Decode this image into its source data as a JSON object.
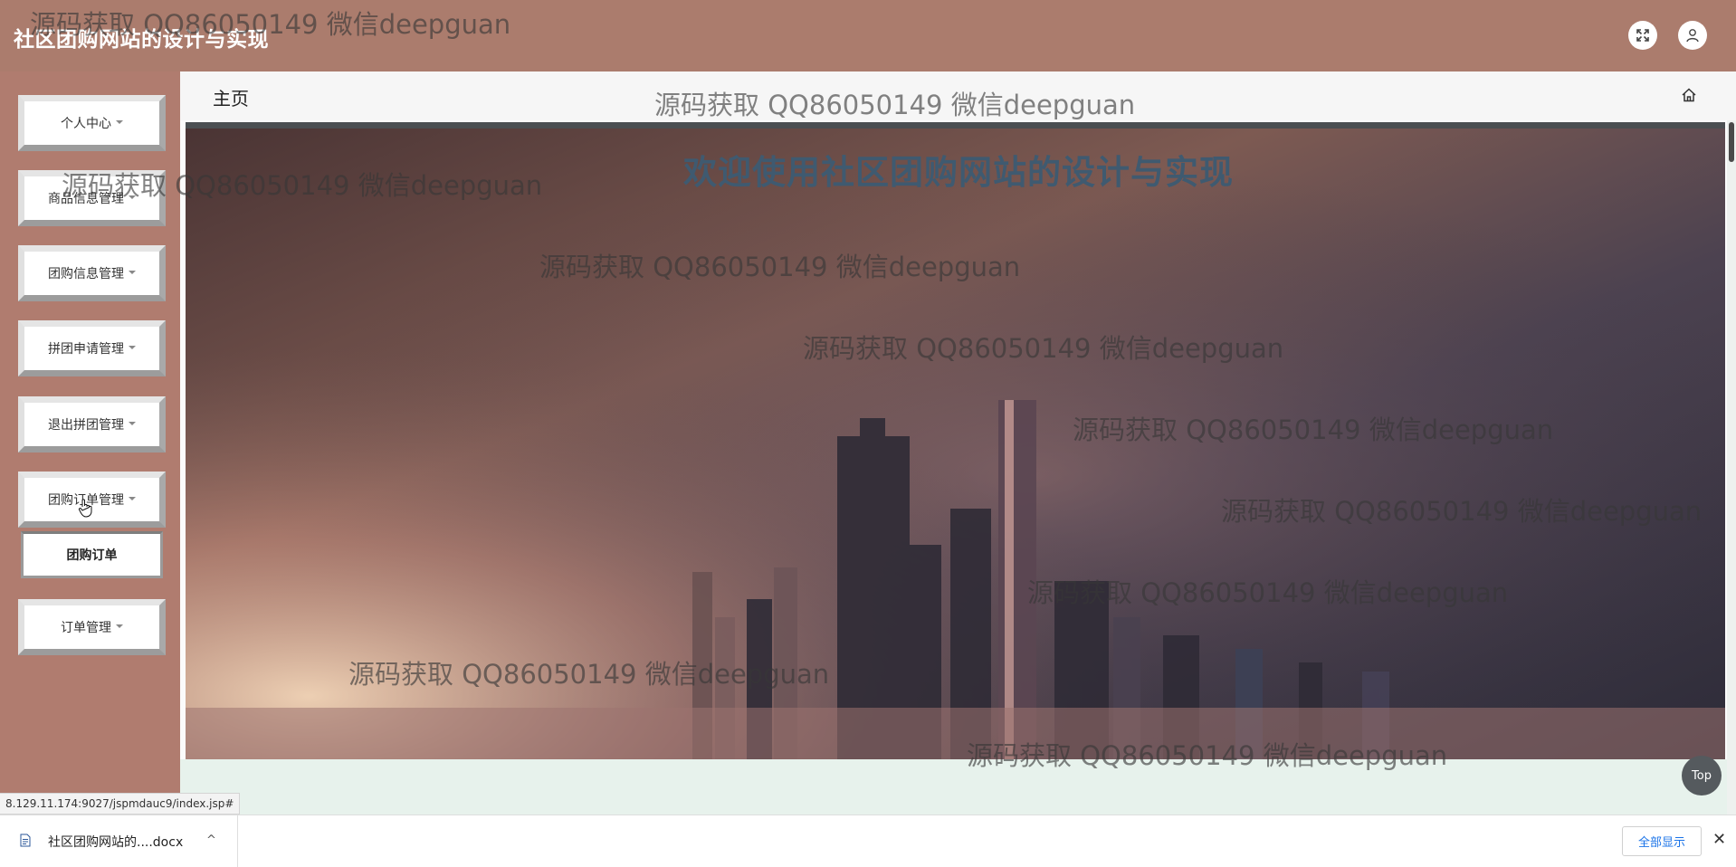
{
  "header": {
    "app_title": "社区团购网站的设计与实现",
    "fullscreen_icon": "fullscreen-icon",
    "user_icon": "user-icon"
  },
  "sidebar": {
    "items": [
      {
        "label": "个人中心"
      },
      {
        "label": "商品信息管理"
      },
      {
        "label": "团购信息管理"
      },
      {
        "label": "拼团申请管理"
      },
      {
        "label": "退出拼团管理"
      },
      {
        "label": "团购订单管理"
      },
      {
        "label": "订单管理"
      }
    ],
    "submenu_item": "团购订单"
  },
  "tabs": {
    "home": "主页",
    "home_icon": "home-icon"
  },
  "main": {
    "welcome_text": "欢迎使用社区团购网站的设计与实现",
    "top_button": "Top"
  },
  "watermark_text": "源码获取 QQ86050149 微信deepguan",
  "status_bar": {
    "url": "8.129.11.174:9027/jspmdauc9/index.jsp#"
  },
  "download_bar": {
    "file_name": "社区团购网站的....docx",
    "show_all_label": "全部显示",
    "close_label": "✕",
    "chevron": "^"
  },
  "colors": {
    "header_bg": "#ab7c6d",
    "sidebar_bg": "#b07c6f",
    "welcome_text": "#3f5a70",
    "accent_link": "#1a73e8"
  }
}
